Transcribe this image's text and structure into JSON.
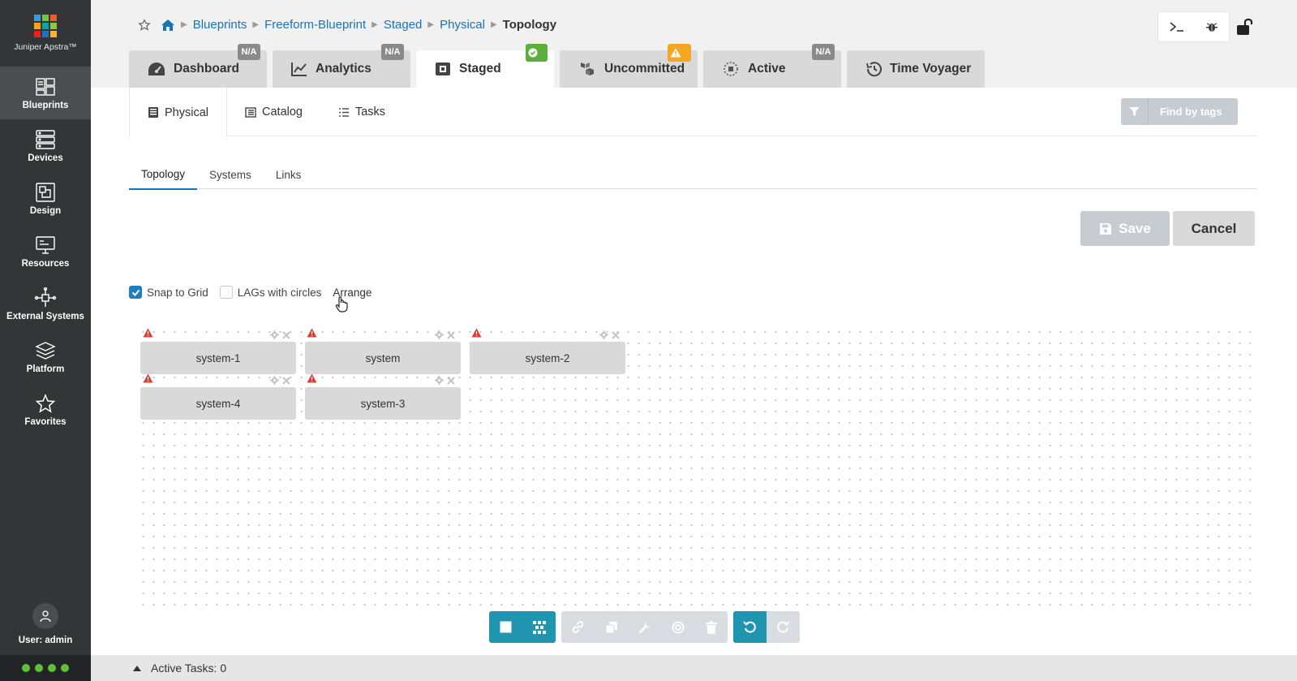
{
  "app": {
    "name": "Juniper Apstra™"
  },
  "sidebar": {
    "items": [
      {
        "label": "Blueprints",
        "icon": "blueprints-icon",
        "active": true
      },
      {
        "label": "Devices",
        "icon": "devices-icon"
      },
      {
        "label": "Design",
        "icon": "design-icon"
      },
      {
        "label": "Resources",
        "icon": "resources-icon"
      },
      {
        "label": "External Systems",
        "icon": "external-systems-icon"
      },
      {
        "label": "Platform",
        "icon": "platform-icon"
      },
      {
        "label": "Favorites",
        "icon": "star-icon"
      }
    ],
    "user_label": "User: admin"
  },
  "breadcrumb": {
    "items": [
      "Blueprints",
      "Freeform-Blueprint",
      "Staged",
      "Physical"
    ],
    "current": "Topology"
  },
  "tabs": [
    {
      "label": "Dashboard",
      "badge": "N/A"
    },
    {
      "label": "Analytics",
      "badge": "N/A"
    },
    {
      "label": "Staged",
      "badge_icon": "check-icon",
      "active": true
    },
    {
      "label": "Uncommitted",
      "badge_icon": "warning-icon"
    },
    {
      "label": "Active",
      "badge": "N/A"
    },
    {
      "label": "Time Voyager"
    }
  ],
  "subtabs": [
    "Physical",
    "Catalog",
    "Tasks"
  ],
  "find_by_tags": "Find by tags",
  "viewtabs": [
    "Topology",
    "Systems",
    "Links"
  ],
  "buttons": {
    "save": "Save",
    "cancel": "Cancel"
  },
  "options": {
    "snap_to_grid": {
      "label": "Snap to Grid",
      "checked": true
    },
    "lags_with_circles": {
      "label": "LAGs with circles",
      "checked": false
    },
    "arrange": "Arrange"
  },
  "nodes": [
    {
      "label": "system-1"
    },
    {
      "label": "system"
    },
    {
      "label": "system-2"
    },
    {
      "label": "system-4"
    },
    {
      "label": "system-3"
    }
  ],
  "active_tasks": "Active Tasks: 0",
  "colors": {
    "accent": "#1a73b5",
    "teal": "#1f95b0",
    "sidebar": "#333537",
    "warning": "#e03c31"
  }
}
